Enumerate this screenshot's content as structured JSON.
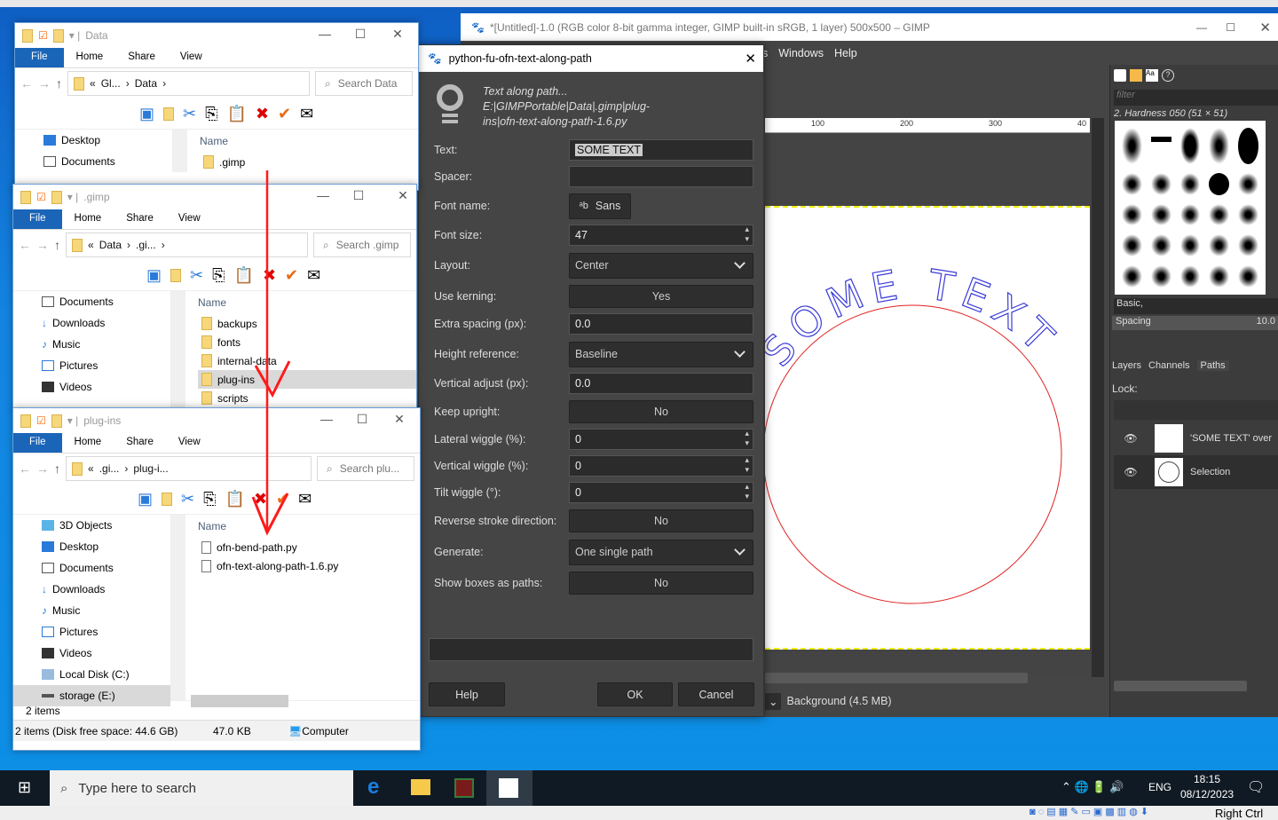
{
  "explorer_windows": [
    {
      "title": "Data",
      "tabs": [
        "File",
        "Home",
        "Share",
        "View"
      ],
      "breadcrumb": [
        "Gl...",
        "Data"
      ],
      "search_placeholder": "Search Data",
      "nav": [
        "Desktop",
        "Documents"
      ],
      "name_header": "Name",
      "files": [
        ".gimp"
      ]
    },
    {
      "title": ".gimp",
      "tabs": [
        "File",
        "Home",
        "Share",
        "View"
      ],
      "breadcrumb": [
        "Data",
        ".gi..."
      ],
      "search_placeholder": "Search .gimp",
      "nav": [
        "Documents",
        "Downloads",
        "Music",
        "Pictures",
        "Videos"
      ],
      "name_header": "Name",
      "files": [
        "backups",
        "fonts",
        "internal-data",
        "plug-ins",
        "scripts"
      ],
      "selected_file": "plug-ins"
    },
    {
      "title": "plug-ins",
      "tabs": [
        "File",
        "Home",
        "Share",
        "View"
      ],
      "breadcrumb": [
        ".gi...",
        "plug-i..."
      ],
      "search_placeholder": "Search plu...",
      "nav": [
        "3D Objects",
        "Desktop",
        "Documents",
        "Downloads",
        "Music",
        "Pictures",
        "Videos",
        "Local Disk (C:)",
        "storage (E:)"
      ],
      "selected_nav": "storage (E:)",
      "name_header": "Name",
      "files": [
        "ofn-bend-path.py",
        "ofn-text-along-path-1.6.py"
      ],
      "item_count": "2 items",
      "status_left": "2 items (Disk free space: 44.6 GB)",
      "status_size": "47.0 KB",
      "status_location": "Computer"
    }
  ],
  "gimp": {
    "title": "*[Untitled]-1.0 (RGB color 8-bit gamma integer, GIMP built-in sRGB, 1 layer) 500x500 – GIMP",
    "menu": [
      "s",
      "Windows",
      "Help"
    ],
    "ruler_ticks": [
      "100",
      "200",
      "300",
      "40"
    ],
    "canvas_text": "SOME TEXT",
    "status_layer": "Background (4.5 MB)",
    "brushes": {
      "filter_placeholder": "filter",
      "selected_brush": "2. Hardness 050 (51 × 51)",
      "tag": "Basic,",
      "spacing_label": "Spacing",
      "spacing_value": "10.0"
    },
    "dock_tabs": [
      "Layers",
      "Channels",
      "Paths"
    ],
    "lock_label": "Lock:",
    "paths": [
      "'SOME TEXT' over",
      "Selection"
    ]
  },
  "dialog": {
    "title": "python-fu-ofn-text-along-path",
    "description": [
      "Text along path...",
      "E:|GIMPPortable|Data|.gimp|plug-",
      "ins|ofn-text-along-path-1.6.py"
    ],
    "fields": [
      {
        "label": "Text:",
        "value": "SOME TEXT"
      },
      {
        "label": "Spacer:",
        "value": ""
      },
      {
        "label": "Font name:",
        "value": "Sans"
      },
      {
        "label": "Font size:",
        "value": "47"
      },
      {
        "label": "Layout:",
        "value": "Center"
      },
      {
        "label": "Use kerning:",
        "value": "Yes"
      },
      {
        "label": "Extra spacing (px):",
        "value": "0.0"
      },
      {
        "label": "Height reference:",
        "value": "Baseline"
      },
      {
        "label": "Vertical adjust (px):",
        "value": "0.0"
      },
      {
        "label": "Keep upright:",
        "value": "No"
      },
      {
        "label": "Lateral wiggle (%):",
        "value": "0"
      },
      {
        "label": "Vertical wiggle (%):",
        "value": "0"
      },
      {
        "label": "Tilt wiggle (°):",
        "value": "0"
      },
      {
        "label": "Reverse stroke direction:",
        "value": "No"
      },
      {
        "label": "Generate:",
        "value": "One single path"
      },
      {
        "label": "Show boxes as paths:",
        "value": "No"
      }
    ],
    "buttons": {
      "help": "Help",
      "ok": "OK",
      "cancel": "Cancel"
    }
  },
  "taskbar": {
    "search_placeholder": "Type here to search",
    "lang": "ENG",
    "time": "18:15",
    "date": "08/12/2023"
  },
  "vbox": {
    "host_key": "Right Ctrl"
  },
  "colors": {
    "arrow": "#ff1a1a",
    "text_path": "#3a3ad8",
    "circle": "#e02020",
    "file_tab": "#1a65b8"
  }
}
